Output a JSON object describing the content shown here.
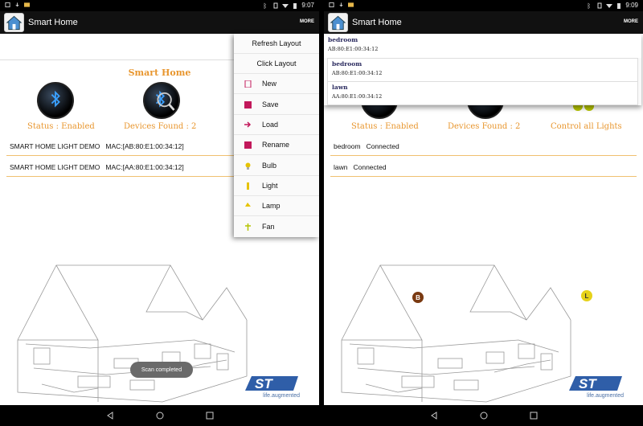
{
  "app_title": "Smart Home",
  "more_label": "MORE",
  "left": {
    "status_time": "9:07",
    "heading": "Smart Home",
    "status": "Status : Enabled",
    "devices_found": "Devices Found : 2",
    "devices": [
      {
        "name": "SMART HOME LIGHT DEMO",
        "mac": "MAC:[AB:80:E1:00:34:12]"
      },
      {
        "name": "SMART HOME LIGHT DEMO",
        "mac": "MAC:[AA:80:E1:00:34:12]"
      }
    ],
    "toast": "Scan completed",
    "menu": [
      {
        "label": "Refresh Layout",
        "icon": "none"
      },
      {
        "label": "Click Layout",
        "icon": "none"
      },
      {
        "label": "New",
        "icon": "new-doc-icon"
      },
      {
        "label": "Save",
        "icon": "save-icon"
      },
      {
        "label": "Load",
        "icon": "load-icon"
      },
      {
        "label": "Rename",
        "icon": "rename-icon"
      },
      {
        "label": "Bulb",
        "icon": "bulb-icon"
      },
      {
        "label": "Light",
        "icon": "light-icon"
      },
      {
        "label": "Lamp",
        "icon": "lamp-icon"
      },
      {
        "label": "Fan",
        "icon": "fan-icon"
      }
    ]
  },
  "right": {
    "status_time": "9:09",
    "status": "Status : Enabled",
    "devices_found": "Devices Found : 2",
    "control_all": "Control all Lights",
    "devices": [
      {
        "name": "bedroom",
        "state": "Connected"
      },
      {
        "name": "lawn",
        "state": "Connected"
      }
    ],
    "dropdown": [
      {
        "name": "bedroom",
        "mac": "AB:80:E1:00:34:12"
      },
      {
        "name": "bedroom",
        "mac": "AB:80:E1:00:34:12"
      },
      {
        "name": "lawn",
        "mac": "AA:80:E1:00:34:12"
      }
    ],
    "markers": [
      {
        "letter": "B",
        "color": "#7a3a12"
      },
      {
        "letter": "L",
        "color": "#e6d21a"
      }
    ]
  },
  "logo_sub": "life.augmented",
  "colors": {
    "accent": "#e8962e",
    "logo_blue": "#2f5ea8"
  }
}
